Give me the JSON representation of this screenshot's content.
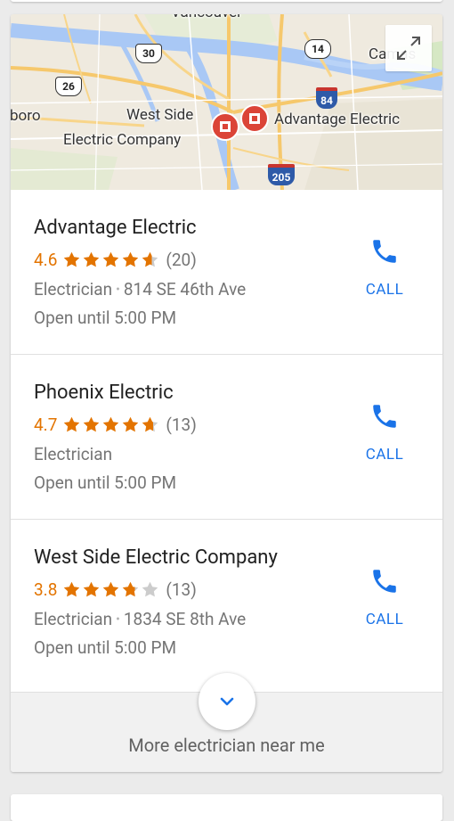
{
  "map": {
    "labels": {
      "city_top": "Vancouver",
      "boro": "boro",
      "west_side_line1": "West Side",
      "west_side_line2": "Electric Company",
      "advantage": "Advantage Electric",
      "camas": "Camas"
    },
    "shields": {
      "r30": "30",
      "r26": "26",
      "r14": "14",
      "i84": "84",
      "i205": "205"
    },
    "expand_icon": "fullscreen-icon"
  },
  "results": [
    {
      "name": "Advantage Electric",
      "rating": "4.6",
      "stars": 4.6,
      "reviews": "(20)",
      "category": "Electrician",
      "address": "814 SE 46th Ave",
      "hours": "Open until 5:00 PM",
      "call_label": "CALL"
    },
    {
      "name": "Phoenix Electric",
      "rating": "4.7",
      "stars": 4.7,
      "reviews": "(13)",
      "category": "Electrician",
      "address": "",
      "hours": "Open until 5:00 PM",
      "call_label": "CALL"
    },
    {
      "name": "West Side Electric Company",
      "rating": "3.8",
      "stars": 3.8,
      "reviews": "(13)",
      "category": "Electrician",
      "address": "1834 SE 8th Ave",
      "hours": "Open until 5:00 PM",
      "call_label": "CALL"
    }
  ],
  "more": {
    "label": "More electrician near me",
    "icon": "chevron-down-icon"
  },
  "colors": {
    "accent": "#1a73e8",
    "rating": "#e37400",
    "star_empty": "#cccccc",
    "marker": "#db4437"
  }
}
